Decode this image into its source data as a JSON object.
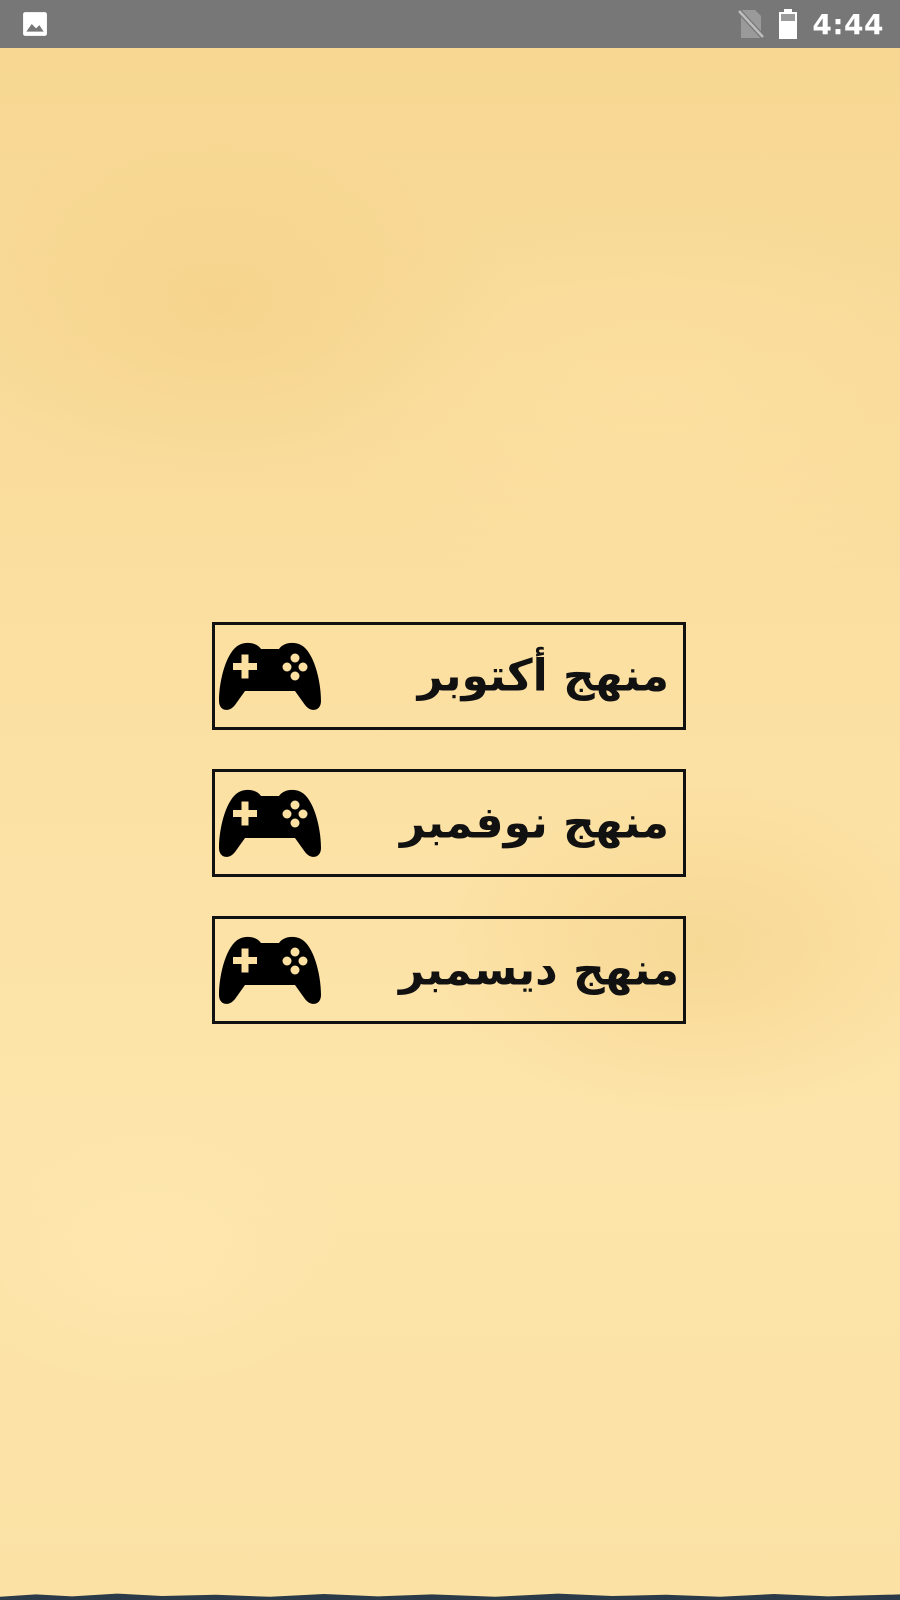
{
  "status_bar": {
    "time": "4:44",
    "left_icon": "image-icon",
    "right_icons": [
      "no-sim-icon",
      "battery-icon"
    ]
  },
  "menu": {
    "items": [
      {
        "label": "منهج أكتوبر",
        "icon": "gamepad-icon"
      },
      {
        "label": "منهج نوفمبر",
        "icon": "gamepad-icon"
      },
      {
        "label": "منهج ديسمبر",
        "icon": "gamepad-icon"
      }
    ]
  },
  "colors": {
    "background": "#fbe0a2",
    "status_bar": "#777777",
    "button_border": "#111111",
    "text": "#111111"
  }
}
